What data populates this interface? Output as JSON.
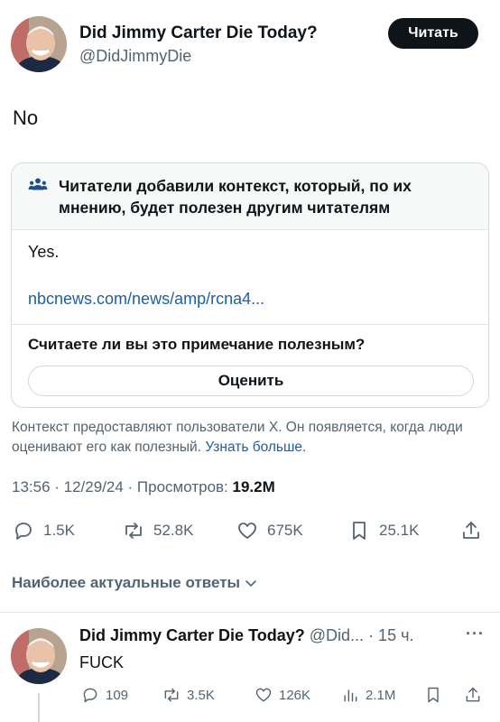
{
  "tweet": {
    "author_name": "Did Jimmy Carter Die Today?",
    "author_handle": "@DidJimmyDie",
    "follow_label": "Читать",
    "text": "No",
    "timestamp": "13:56 · 12/29/24 · Просмотров: ",
    "views": "19.2M"
  },
  "community_note": {
    "header": "Читатели добавили контекст, который, по их мнению, будет полезен другим читателям",
    "body": "Yes.",
    "link": "nbcnews.com/news/amp/rcna4...",
    "question": "Считаете ли вы это примечание полезным?",
    "rate_label": "Оценить"
  },
  "context_info": {
    "text": "Контекст предоставляют пользователи X. Он появляется, когда люди оценивают его как полезный.",
    "learn_more": "Узнать больше."
  },
  "actions": {
    "replies": "1.5K",
    "reposts": "52.8K",
    "likes": "675K",
    "bookmarks": "25.1K"
  },
  "sort_label": "Наиболее актуальные ответы",
  "reply": {
    "author_name": "Did Jimmy Carter Die Today?",
    "author_handle": "@Did...",
    "time": "· 15 ч.",
    "more": "···",
    "text": "FUCK",
    "replies": "109",
    "reposts": "3.5K",
    "likes": "126K",
    "views": "2.1M"
  },
  "colors": {
    "text": "#0f1419",
    "secondary": "#536471",
    "link": "#1d5fa6",
    "note_header_bg": "#f7f9f9"
  }
}
